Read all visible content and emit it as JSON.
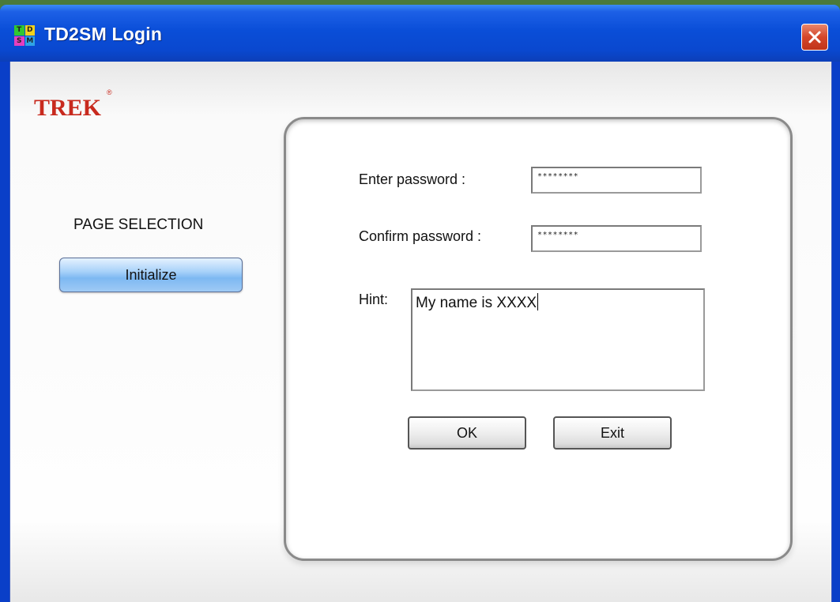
{
  "window": {
    "title": "TD2SM Login",
    "icon_name": "td2sm-app-icon",
    "icon_letters": [
      "T",
      "D",
      "S",
      "M"
    ]
  },
  "logo": {
    "text": "TREK",
    "registered_mark": "®"
  },
  "sidebar": {
    "heading": "PAGE SELECTION",
    "items": [
      {
        "label": "Initialize",
        "selected": true
      }
    ]
  },
  "form": {
    "password_label": "Enter password :",
    "password_value": "********",
    "confirm_label": "Confirm password :",
    "confirm_value": "********",
    "hint_label": "Hint:",
    "hint_value": "My name is XXXX"
  },
  "buttons": {
    "ok_label": "OK",
    "exit_label": "Exit"
  },
  "colors": {
    "titlebar": "#0a4ed8",
    "logo_red": "#c82a1e",
    "close_button": "#d4462a",
    "selected_item": "#a8d1f9"
  }
}
